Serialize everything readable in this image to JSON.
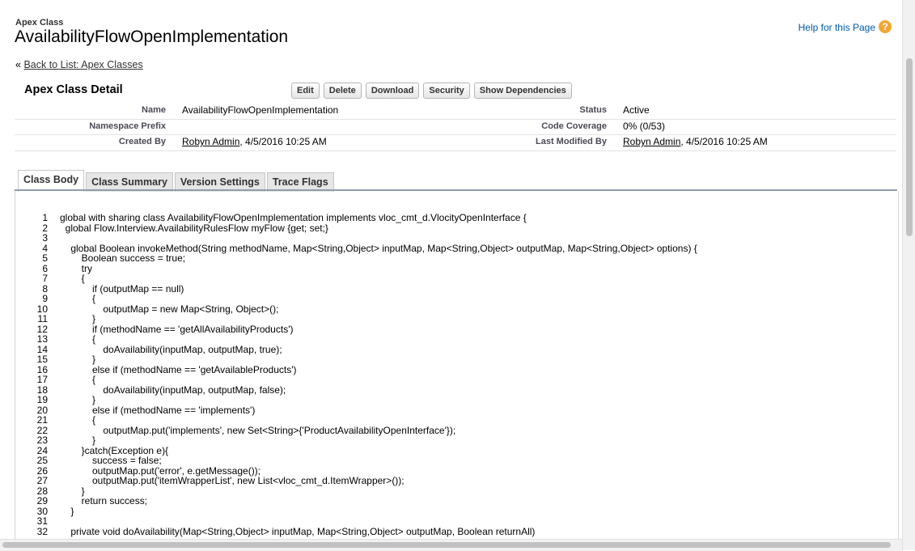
{
  "header": {
    "type_label": "Apex Class",
    "title": "AvailabilityFlowOpenImplementation",
    "help_link": "Help for this Page",
    "help_icon": "question-icon"
  },
  "back": {
    "prefix": "« ",
    "link": "Back to List: Apex Classes"
  },
  "detail": {
    "title": "Apex Class Detail",
    "buttons": [
      "Edit",
      "Delete",
      "Download",
      "Security",
      "Show Dependencies"
    ],
    "fields": {
      "name_label": "Name",
      "name_value": "AvailabilityFlowOpenImplementation",
      "status_label": "Status",
      "status_value": "Active",
      "namespace_label": "Namespace Prefix",
      "namespace_value": "",
      "coverage_label": "Code Coverage",
      "coverage_value": "0% (0/53)",
      "created_label": "Created By",
      "created_user": "Robyn Admin",
      "created_date": ",  4/5/2016 10:25 AM",
      "modified_label": "Last Modified By",
      "modified_user": "Robyn Admin",
      "modified_date": ",  4/5/2016 10:25 AM"
    }
  },
  "tabs": [
    "Class Body",
    "Class Summary",
    "Version Settings",
    "Trace Flags"
  ],
  "code_lines": [
    "global with sharing class AvailabilityFlowOpenImplementation implements vloc_cmt_d.VlocityOpenInterface {",
    "  global Flow.Interview.AvailabilityRulesFlow myFlow {get; set;}",
    "",
    "    global Boolean invokeMethod(String methodName, Map<String,Object> inputMap, Map<String,Object> outputMap, Map<String,Object> options) {",
    "        Boolean success = true;",
    "        try",
    "        {",
    "            if (outputMap == null)",
    "            {",
    "                outputMap = new Map<String, Object>();",
    "            }",
    "            if (methodName == 'getAllAvailabilityProducts')",
    "            {",
    "                doAvailability(inputMap, outputMap, true);",
    "            }",
    "            else if (methodName == 'getAvailableProducts')",
    "            {",
    "                doAvailability(inputMap, outputMap, false);",
    "            }",
    "            else if (methodName == 'implements')",
    "            {",
    "                outputMap.put('implements', new Set<String>{'ProductAvailabilityOpenInterface'});",
    "            }",
    "        }catch(Exception e){",
    "            success = false;",
    "            outputMap.put('error', e.getMessage());",
    "            outputMap.put('itemWrapperList', new List<vloc_cmt_d.ItemWrapper>());",
    "        }",
    "        return success;",
    "    }",
    "",
    "    private void doAvailability(Map<String,Object> inputMap, Map<String,Object> outputMap, Boolean returnAll)"
  ]
}
